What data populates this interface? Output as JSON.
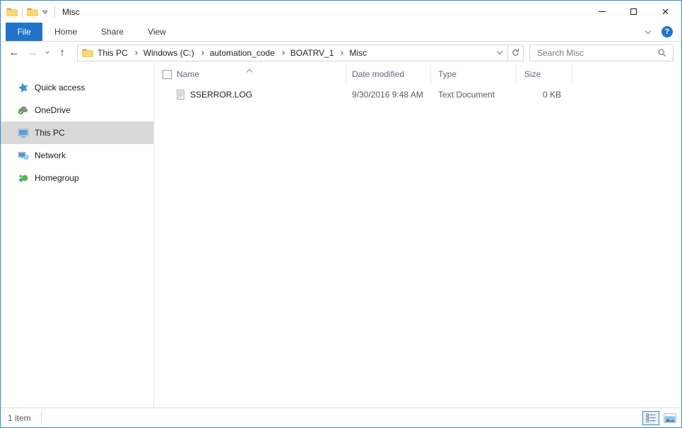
{
  "titlebar": {
    "title": "Misc"
  },
  "ribbon": {
    "tabs": [
      "File",
      "Home",
      "Share",
      "View"
    ],
    "selected_tab": "File",
    "help_label": "?"
  },
  "address_bar": {
    "breadcrumb": [
      "This PC",
      "Windows (C:)",
      "automation_code",
      "BOATRV_1",
      "Misc"
    ],
    "search_placeholder": "Search Misc"
  },
  "sidebar": {
    "items": [
      {
        "label": "Quick access",
        "icon": "quick-access-star",
        "selected": false
      },
      {
        "label": "OneDrive",
        "icon": "onedrive-cloud",
        "selected": false
      },
      {
        "label": "This PC",
        "icon": "this-pc-monitor",
        "selected": true
      },
      {
        "label": "Network",
        "icon": "network",
        "selected": false
      },
      {
        "label": "Homegroup",
        "icon": "homegroup",
        "selected": false
      }
    ]
  },
  "file_list": {
    "columns": [
      "Name",
      "Date modified",
      "Type",
      "Size"
    ],
    "sort": {
      "column": "Name",
      "direction": "ascending"
    },
    "rows": [
      {
        "name": "SSERROR.LOG",
        "date_modified": "9/30/2016 9:48 AM",
        "type": "Text Document",
        "size": "0 KB",
        "icon": "text-document"
      }
    ]
  },
  "status_bar": {
    "item_count": "1 item"
  },
  "view_toggles": {
    "selected": "details",
    "options": [
      "details",
      "large-icons"
    ]
  },
  "colors": {
    "accent": "#2b8dd6",
    "file_tab": "#2173ca",
    "selected_item_bg": "#d9d9d9",
    "help_circle": "#2173ca"
  }
}
